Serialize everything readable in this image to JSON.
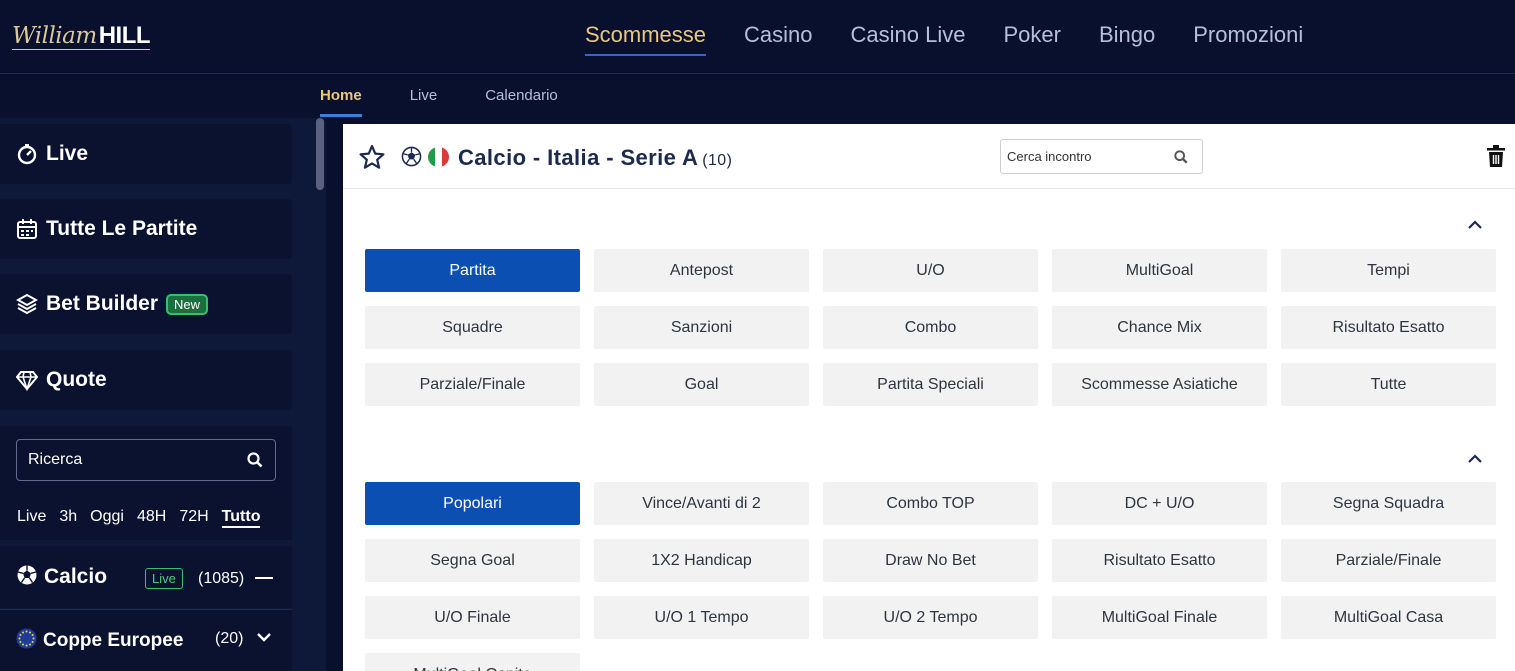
{
  "brand": {
    "script": "William",
    "bold": "HILL"
  },
  "main_nav": [
    {
      "label": "Scommesse",
      "active": true
    },
    {
      "label": "Casino",
      "active": false
    },
    {
      "label": "Casino Live",
      "active": false
    },
    {
      "label": "Poker",
      "active": false
    },
    {
      "label": "Bingo",
      "active": false
    },
    {
      "label": "Promozioni",
      "active": false
    }
  ],
  "sub_nav": [
    {
      "label": "Home",
      "active": true
    },
    {
      "label": "Live",
      "active": false
    },
    {
      "label": "Calendario",
      "active": false
    }
  ],
  "sidebar": {
    "live": "Live",
    "all_matches": "Tutte Le Partite",
    "bet_builder": "Bet Builder",
    "bet_builder_badge": "New",
    "quotes": "Quote",
    "search_placeholder": "Ricerca",
    "time_filters": [
      "Live",
      "3h",
      "Oggi",
      "48H",
      "72H",
      "Tutto"
    ],
    "time_filter_active": "Tutto",
    "sport": {
      "label": "Calcio",
      "live_badge": "Live",
      "count": "(1085)"
    },
    "sub_sport": {
      "label": "Coppe Europee",
      "count": "(20)"
    }
  },
  "competition": {
    "title": "Calcio - Italia - Serie A",
    "count": "(10)",
    "search_placeholder": "Cerca incontro"
  },
  "market_groups": [
    "Partita",
    "Antepost",
    "U/O",
    "MultiGoal",
    "Tempi",
    "Squadre",
    "Sanzioni",
    "Combo",
    "Chance Mix",
    "Risultato Esatto",
    "Parziale/Finale",
    "Goal",
    "Partita Speciali",
    "Scommesse Asiatiche",
    "Tutte"
  ],
  "market_groups_active": "Partita",
  "markets": [
    "Popolari",
    "Vince/Avanti di 2",
    "Combo TOP",
    "DC + U/O",
    "Segna Squadra",
    "Segna Goal",
    "1X2 Handicap",
    "Draw No Bet",
    "Risultato Esatto",
    "Parziale/Finale",
    "U/O Finale",
    "U/O 1 Tempo",
    "U/O 2 Tempo",
    "MultiGoal Finale",
    "MultiGoal Casa",
    "MultiGoal Ospite"
  ],
  "markets_active": "Popolari",
  "colors": {
    "header_bg": "#08102e",
    "accent_gold": "#e9c77b",
    "active_button": "#0c4fb2",
    "live_green": "#37c06a"
  },
  "icons": [
    "stopwatch-icon",
    "calendar-icon",
    "bet-builder-icon",
    "diamond-icon",
    "search-icon",
    "soccer-ball-icon",
    "eu-flag-icon",
    "chevron-down-icon",
    "star-icon",
    "italy-flag-icon",
    "trash-icon",
    "chevron-up-icon"
  ]
}
